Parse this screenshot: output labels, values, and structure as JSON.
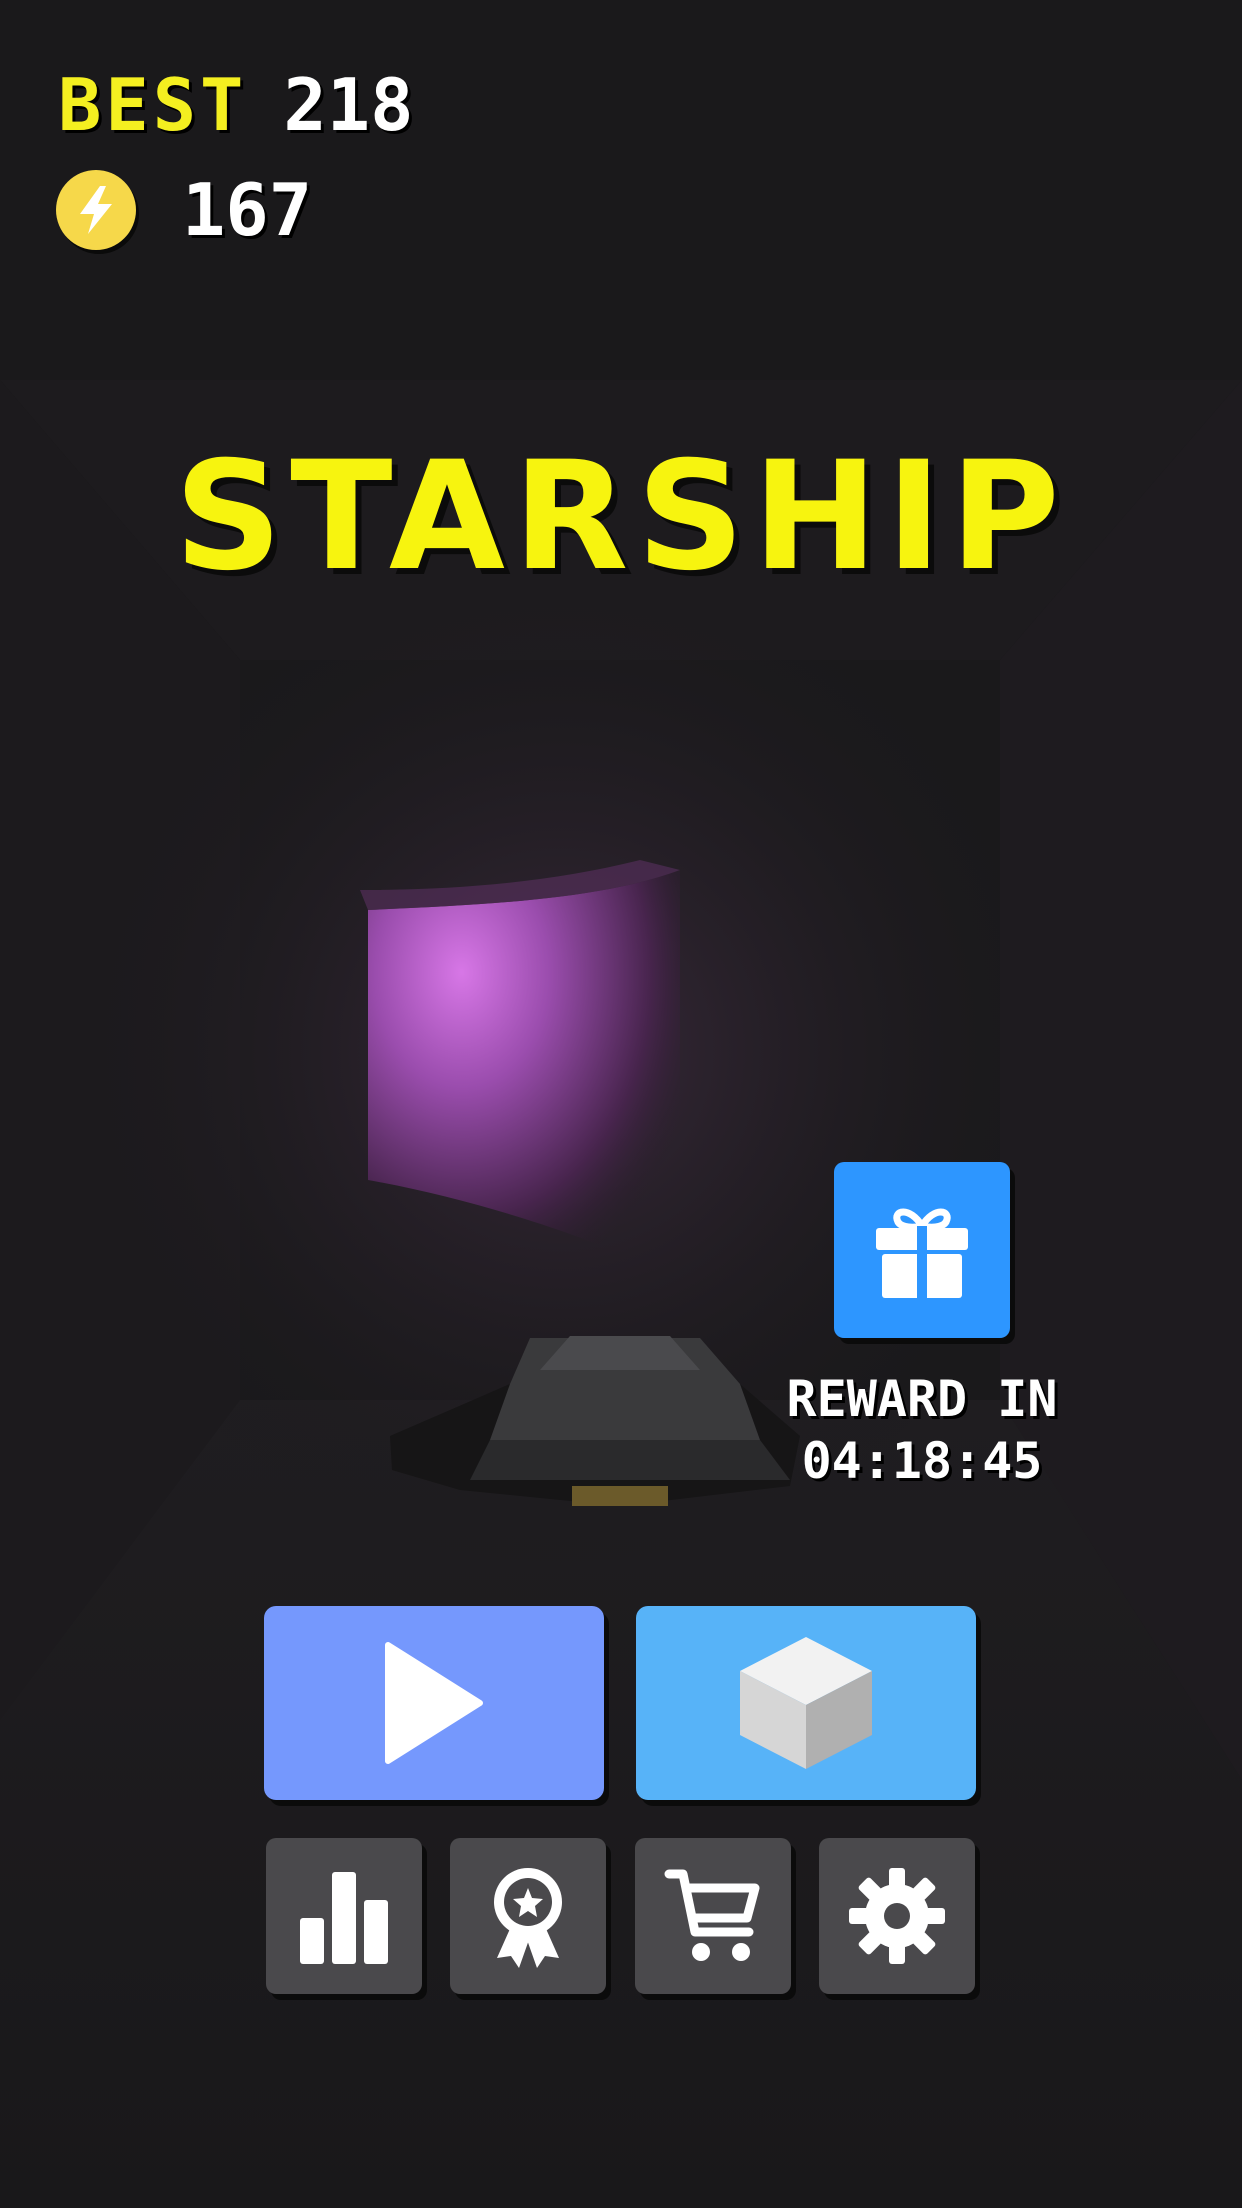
{
  "hud": {
    "best_label": "BEST",
    "best_value": "218",
    "coins_value": "167"
  },
  "title": "STARSHIP",
  "reward": {
    "line1": "REWARD IN",
    "line2": "04:18:45"
  },
  "buttons": {
    "play_icon": "play-icon",
    "ship_icon": "cube-icon",
    "leaderboard_icon": "bar-chart-icon",
    "achievements_icon": "award-ribbon-icon",
    "shop_icon": "shopping-cart-icon",
    "settings_icon": "gear-icon",
    "gift_icon": "gift-icon"
  },
  "colors": {
    "title": "#f7f40f",
    "best_label": "#f4ef20",
    "coin": "#f6d84a",
    "play_button": "#7598fd",
    "ship_button": "#57b3f8",
    "gift_button": "#2d96ff",
    "small_button": "#4a494c",
    "tunnel_glow": "#d96fe6",
    "background": "#1a191b"
  }
}
